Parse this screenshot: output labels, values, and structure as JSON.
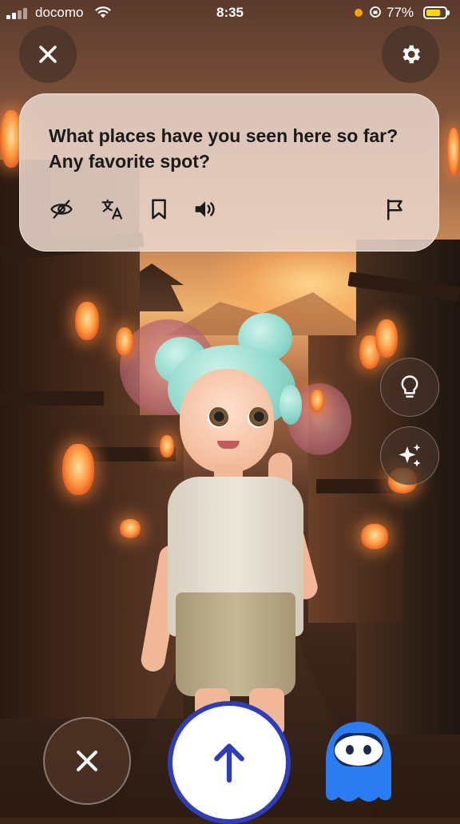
{
  "status_bar": {
    "carrier": "docomo",
    "time": "8:35",
    "battery_percent": "77%",
    "battery_level": 0.77,
    "battery_color": "#ffd60a",
    "privacy_dot_color": "#ff9f0a"
  },
  "header": {
    "close_icon": "close-icon",
    "settings_icon": "gear-icon"
  },
  "message_card": {
    "question": "What places have you seen here so far? Any favorite spot?",
    "actions": [
      {
        "name": "hide-text-icon"
      },
      {
        "name": "translate-icon"
      },
      {
        "name": "bookmark-icon"
      },
      {
        "name": "speaker-icon"
      },
      {
        "name": "report-flag-icon"
      }
    ]
  },
  "side_actions": [
    {
      "name": "hint-lightbulb-icon"
    },
    {
      "name": "sparkles-icon"
    }
  ],
  "bottom_bar": {
    "cancel_icon": "close-icon",
    "send_icon": "arrow-up-icon",
    "send_accent": "#2f3eb8",
    "mascot_color": "#2a7cf0"
  }
}
